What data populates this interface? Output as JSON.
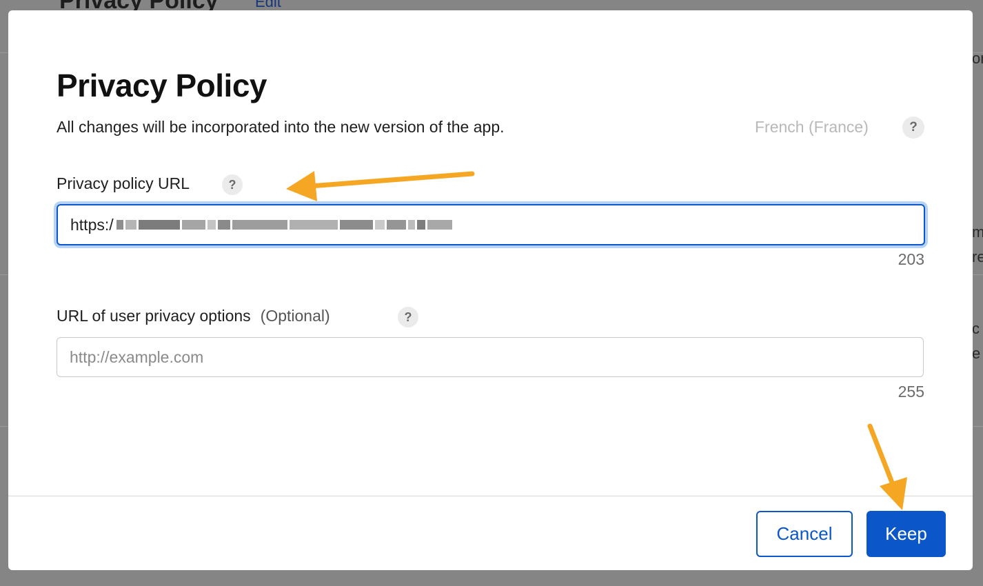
{
  "background": {
    "title": "Privacy Policy",
    "edit_link": "Edit",
    "right_fragments": [
      "or",
      "m",
      "re",
      "c",
      "e"
    ]
  },
  "modal": {
    "title": "Privacy Policy",
    "subtitle": "All changes will be incorporated into the new version of the app.",
    "language": "French (France)",
    "help_glyph": "?",
    "privacy_url": {
      "label": "Privacy policy URL",
      "value": "https:/",
      "counter": "203"
    },
    "privacy_options": {
      "label": "URL of user privacy options",
      "optional": "(Optional)",
      "placeholder": "http://example.com",
      "counter": "255"
    },
    "buttons": {
      "cancel": "Cancel",
      "keep": "Keep"
    }
  },
  "colors": {
    "accent": "#0b57c9",
    "annotation_arrow": "#f5a623"
  }
}
